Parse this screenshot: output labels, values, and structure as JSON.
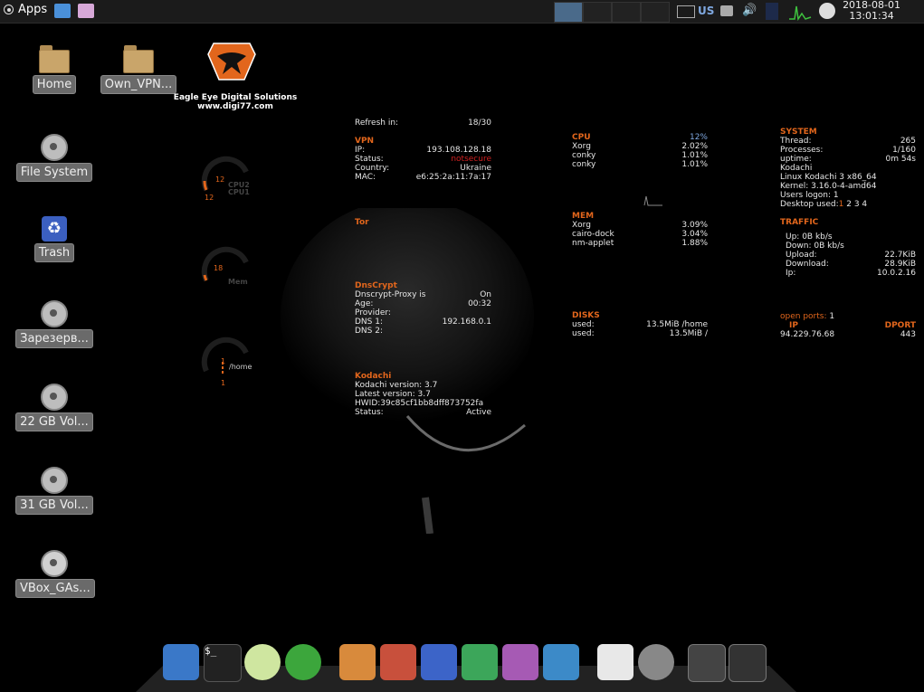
{
  "panel": {
    "apps_label": "Apps",
    "keyboard_layout": "US",
    "clock_date": "2018-08-01",
    "clock_time": "13:01:34"
  },
  "desktop_icons": [
    {
      "label": "Home"
    },
    {
      "label": "Own_VPN..."
    },
    {
      "label": "File System"
    },
    {
      "label": "Trash"
    },
    {
      "label": "Зарезерв..."
    },
    {
      "label": "22 GB Vol..."
    },
    {
      "label": "31 GB Vol..."
    },
    {
      "label": "VBox_GAs..."
    }
  ],
  "logo": {
    "company": "Eagle Eye Digital Solutions",
    "website": "www.digi77.com"
  },
  "gauges": {
    "cpu_val1": "12",
    "cpu_val2": "12",
    "cpu_label2": "CPU2",
    "cpu_label1": "CPU1",
    "mem_val": "18",
    "mem_label": "Mem",
    "home_val1": "1",
    "home_val2": "1",
    "home_label": "/home"
  },
  "refresh": {
    "label": "Refresh in:",
    "value": "18/30"
  },
  "vpn": {
    "heading": "VPN",
    "ip_label": "IP:",
    "ip": "193.108.128.18",
    "status_label": "Status:",
    "status": "notsecure",
    "country_label": "Country:",
    "country": "Ukraine",
    "mac_label": "MAC:",
    "mac": "e6:25:2a:11:7a:17"
  },
  "tor": {
    "heading": "Tor"
  },
  "dnscrypt": {
    "heading": "DnsCrypt",
    "proxy_label": "Dnscrypt-Proxy is",
    "proxy": "On",
    "age_label": "Age:",
    "age": "00:32",
    "provider_label": "Provider:",
    "dns1_label": "DNS 1:",
    "dns1": "192.168.0.1",
    "dns2_label": "DNS 2:"
  },
  "kodachi": {
    "heading": "Kodachi",
    "version": "Kodachi  version: 3.7",
    "latest": "Latest   version: 3.7",
    "hwid": "HWID:39c85cf1bb8dff873752fa",
    "status_label": "Status:",
    "status": "Active"
  },
  "cpu": {
    "heading": "CPU",
    "total": "12%",
    "procs": [
      {
        "name": "Xorg",
        "value": "2.02%"
      },
      {
        "name": "conky",
        "value": "1.01%"
      },
      {
        "name": "conky",
        "value": "1.01%"
      }
    ]
  },
  "mem": {
    "heading": "MEM",
    "procs": [
      {
        "name": "Xorg",
        "value": "3.09%"
      },
      {
        "name": "cairo-dock",
        "value": "3.04%"
      },
      {
        "name": "nm-applet",
        "value": "1.88%"
      }
    ]
  },
  "disks": {
    "heading": "DISKS",
    "rows": [
      {
        "label": "used:",
        "value": "13.5MiB /home"
      },
      {
        "label": "used:",
        "value": "13.5MiB /"
      }
    ]
  },
  "system": {
    "heading": "SYSTEM",
    "thread_label": "Thread:",
    "thread": "265",
    "processes_label": "Processes:",
    "processes": "1/160",
    "uptime_label": "uptime:",
    "uptime": "0m 54s",
    "hostname": "Kodachi",
    "os": "Linux Kodachi 3  x86_64",
    "kernel": "Kernel: 3.16.0-4-amd64",
    "users": "Users logon: 1",
    "desktop_label": "Desktop used:",
    "desktop_active": "1",
    "desktop_rest": " 2 3 4"
  },
  "traffic": {
    "heading": "TRAFFIC",
    "up": "Up: 0B   kb/s",
    "down": "Down: 0B   kb/s",
    "upload_label": "Upload:",
    "upload": "22.7KiB",
    "download_label": "Download:",
    "download": "28.9KiB",
    "ip_label": "Ip:",
    "ip": "10.0.2.16"
  },
  "ports": {
    "label": "open ports:",
    "count": "1",
    "ip_header": "IP",
    "dport_header": "DPORT",
    "ip": "94.229.76.68",
    "dport": "443"
  },
  "dock_items": [
    "display-icon",
    "terminal-icon",
    "disc-burner-icon",
    "globe-icon",
    "home-folder-icon",
    "tools-folder-icon",
    "network-folder-icon",
    "downloads-folder-icon",
    "docs-folder-icon",
    "share-folder-icon",
    "text-editor-icon",
    "search-clock-icon",
    "power-icon",
    "home-icon"
  ]
}
